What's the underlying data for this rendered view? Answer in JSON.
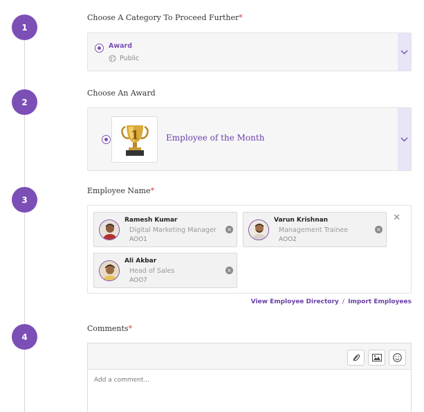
{
  "steps": [
    "1",
    "2",
    "3",
    "4"
  ],
  "category": {
    "label": "Choose A Category To Proceed Further",
    "required_mark": "*",
    "selected_title": "Award",
    "selected_sub": "Public"
  },
  "award": {
    "label": "Choose An Award",
    "selected_name": "Employee of the Month"
  },
  "employees": {
    "label": "Employee Name",
    "required_mark": "*",
    "items": [
      {
        "name": "Ramesh Kumar",
        "role": "Digital Marketing Manager",
        "id": "AOO1"
      },
      {
        "name": "Varun Krishnan",
        "role": "Management Trainee",
        "id": "AOO2"
      },
      {
        "name": "Ali Akbar",
        "role": "Head of Sales",
        "id": "AOO7"
      }
    ],
    "clear_icon": "✕",
    "remove_icon": "×"
  },
  "links": {
    "directory": "View Employee Directory",
    "separator": "/",
    "import": "Import Employees"
  },
  "comments": {
    "label": "Comments",
    "required_mark": "*",
    "placeholder": "Add a comment..."
  },
  "colors": {
    "accent": "#7b4fb6",
    "required": "#d83a3a",
    "link": "#6a3fa8"
  },
  "icons": {
    "attach": "paperclip-icon",
    "image": "image-icon",
    "emoji": "smiley-icon",
    "globe": "globe-icon",
    "chevron": "chevron-down-icon"
  }
}
